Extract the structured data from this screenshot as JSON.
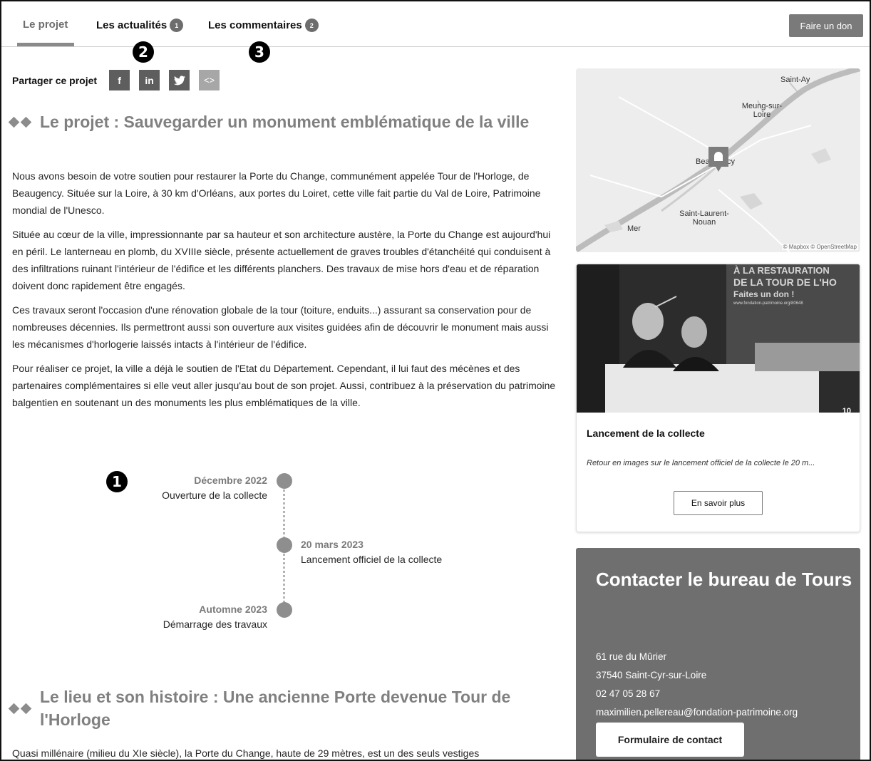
{
  "nav": {
    "tabs": [
      {
        "label": "Le projet"
      },
      {
        "label": "Les actualités",
        "badge": "1"
      },
      {
        "label": "Les commentaires",
        "badge": "2"
      }
    ],
    "donate_label": "Faire un don"
  },
  "callouts": {
    "one": "1",
    "two": "2",
    "three": "3"
  },
  "share": {
    "label": "Partager ce projet",
    "buttons": [
      {
        "icon": "facebook-icon",
        "glyph": "f"
      },
      {
        "icon": "linkedin-icon",
        "glyph": "in"
      },
      {
        "icon": "twitter-icon",
        "glyph": "🐦"
      },
      {
        "icon": "embed-icon",
        "glyph": "<>"
      }
    ]
  },
  "project": {
    "title": "Le projet : Sauvegarder un monument emblématique de la ville",
    "paragraphs": [
      "Nous avons besoin de votre soutien pour restaurer la Porte du Change, communément appelée Tour de l'Horloge, de Beaugency. Située sur la Loire, à 30 km d'Orléans, aux portes du Loiret, cette ville fait partie du Val de Loire, Patrimoine mondial de l'Unesco.",
      "Située au cœur de la ville, impressionnante par sa hauteur et son architecture austère, la Porte du Change est aujourd'hui en péril. Le lanterneau en plomb, du XVIIIe siècle, présente actuellement de graves troubles d'étanchéité qui conduisent à des infiltrations ruinant l'intérieur de l'édifice et les différents planchers. Des travaux de mise hors d'eau et de réparation doivent donc rapidement être engagés.",
      "Ces travaux seront l'occasion d'une rénovation globale de la tour (toiture, enduits...) assurant sa conservation pour de nombreuses décennies. Ils permettront aussi son ouverture aux visites guidées afin de découvrir le monument mais aussi les mécanismes d'horlogerie laissés intacts à l'intérieur de l'édifice.",
      "Pour réaliser ce projet, la ville a déjà le soutien de l'Etat du Département. Cependant, il lui faut des mécènes et des partenaires complémentaires si elle veut aller jusqu'au bout de son projet. Aussi, contribuez à la préservation du patrimoine balgentien en soutenant un des monuments les plus emblématiques de la ville."
    ]
  },
  "timeline": [
    {
      "date": "Décembre 2022",
      "desc": "Ouverture de la collecte"
    },
    {
      "date": "20 mars 2023",
      "desc": "Lancement officiel de la collecte"
    },
    {
      "date": "Automne 2023",
      "desc": "Démarrage des travaux"
    }
  ],
  "history": {
    "title": "Le lieu et son histoire : Une ancienne Porte devenue Tour de l'Horloge",
    "intro": "Quasi millénaire (milieu du XIe siècle), la Porte du Change, haute de 29 mètres, est un des seuls vestiges"
  },
  "map": {
    "places": [
      "Saint-Ay",
      "Meung-sur-Loire",
      "Beaugency",
      "Saint-Laurent-Nouan",
      "Mer"
    ],
    "attribution": "© Mapbox © OpenStreetMap"
  },
  "news": {
    "photo_banner": [
      "À LA RESTAURATION",
      "DE LA TOUR DE L'HO",
      "Faites un don !",
      "www.fondation-patrimoine.org/80648"
    ],
    "photo_corner": "10",
    "title": "Lancement de la collecte",
    "excerpt": "Retour en images sur le lancement officiel de la collecte le 20 m...",
    "button": "En savoir plus"
  },
  "contact": {
    "title": "Contacter le bureau de Tours",
    "lines": [
      "61 rue du Mûrier",
      "37540 Saint-Cyr-sur-Loire",
      "02 47 05 28 67",
      "maximilien.pellereau@fondation-patrimoine.org"
    ],
    "button": "Formulaire de contact"
  }
}
